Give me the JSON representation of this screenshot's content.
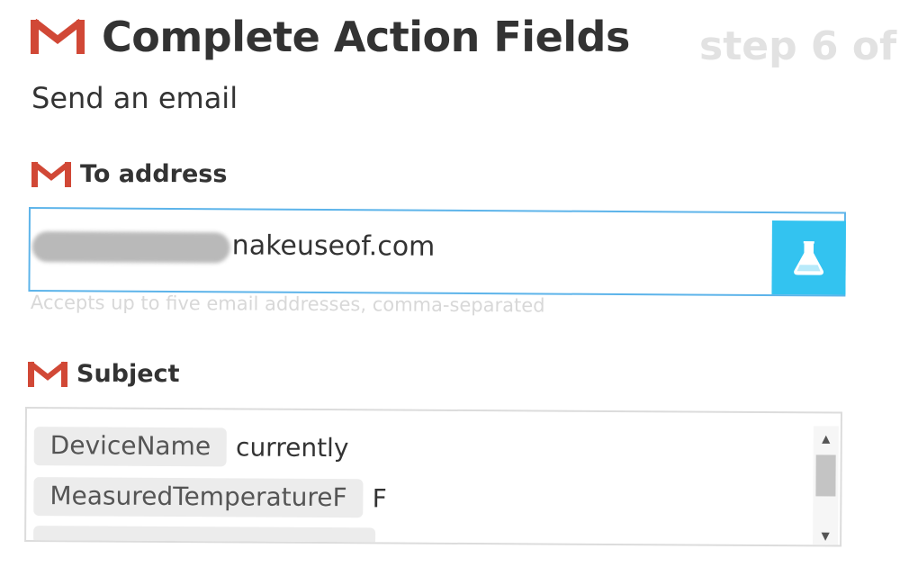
{
  "header": {
    "title": "Complete Action Fields",
    "step": "step 6 of",
    "subtitle": "Send an email",
    "service_icon": "gmail-icon"
  },
  "colors": {
    "gmail_red": "#d14836",
    "input_border": "#5db4ea",
    "test_button": "#33c3f0",
    "help_text": "#d8d8d8",
    "pill_bg": "#ececec"
  },
  "to_address": {
    "label": "To address",
    "value_visible": "nakeuseof.com",
    "help": "Accepts up to five email addresses, comma-separated",
    "button_icon": "flask-icon"
  },
  "subject": {
    "label": "Subject",
    "lines": [
      {
        "ingredient": "DeviceName",
        "text": "currently"
      },
      {
        "ingredient": "MeasuredTemperatureF",
        "text": "F"
      }
    ]
  }
}
